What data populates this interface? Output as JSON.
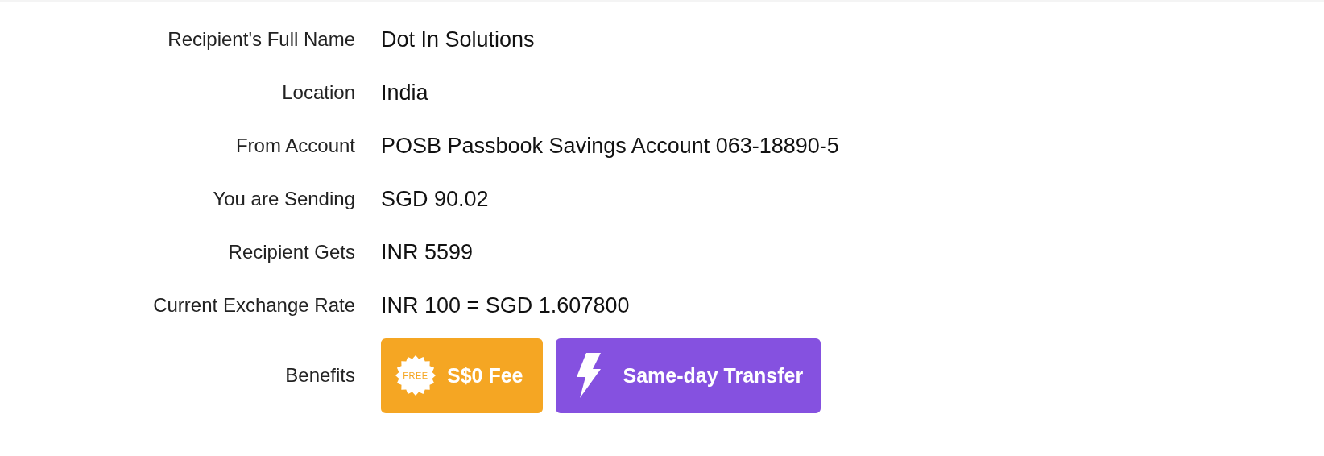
{
  "details": [
    {
      "label": "Recipient's Full Name",
      "value": "Dot In Solutions"
    },
    {
      "label": "Location",
      "value": "India"
    },
    {
      "label": "From Account",
      "value": "POSB Passbook Savings Account 063-18890-5"
    },
    {
      "label": "You are Sending",
      "value": "SGD 90.02"
    },
    {
      "label": "Recipient Gets",
      "value": "INR 5599"
    },
    {
      "label": "Current Exchange Rate",
      "value": "INR 100 = SGD 1.607800"
    }
  ],
  "benefits": {
    "label": "Benefits",
    "items": [
      {
        "kind": "free",
        "badge": "FREE",
        "text": "S$0 Fee",
        "color": "#f5a623"
      },
      {
        "kind": "fast",
        "text": "Same-day Transfer",
        "color": "#8551e0"
      }
    ]
  }
}
